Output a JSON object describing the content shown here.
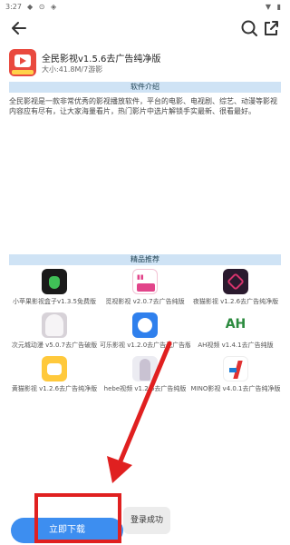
{
  "status_bar": {
    "time": "3:27",
    "left_icons": "◆ ⊙ ◈",
    "right_icons": "▼ ▮"
  },
  "app": {
    "title": "全民影视v1.5.6去广告纯净版",
    "meta": "大小:41.8M/7游影"
  },
  "sections": {
    "intro": "软件介绍",
    "recommend": "精品推荐"
  },
  "description": "全民影视是一款非常优秀的影视播放软件，平台的电影、电视剧、综艺、动漫等影视内容应有尽有，让大家海量看片，热门影片中选片解锁手实最新、很看最好。",
  "recommend_items": [
    {
      "name": "小苹果影视盒子v1.3.5免费版",
      "icon": "green-apple-icon"
    },
    {
      "name": "觅视影视 v2.0.7去广告纯版",
      "icon": "pink-video-icon"
    },
    {
      "name": "夜猫影视 v1.2.6去广告纯净版",
      "icon": "dark-diamond-icon"
    },
    {
      "name": "次元城动漫 v5.0.7去广告破版",
      "icon": "anime-girl-icon"
    },
    {
      "name": "可乐影视 v1.2.0去广告无广告版",
      "icon": "blue-mascot-icon"
    },
    {
      "name": "AH视频 v1.4.1去广告纯版",
      "icon": "ah-logo-icon"
    },
    {
      "name": "黄猫影视 v1.2.6去广告纯净版",
      "icon": "yellow-cat-icon"
    },
    {
      "name": "hebe视频 v1.2.6去广告纯版",
      "icon": "photo-person-icon"
    },
    {
      "name": "MINO影视 v4.0.1去广告纯净版",
      "icon": "mino-logo-icon"
    }
  ],
  "download_button": "立即下载",
  "toast": "登录成功",
  "colors": {
    "accent": "#3d8ef0",
    "section_bar": "#cfe3f5",
    "highlight": "#e02020"
  }
}
